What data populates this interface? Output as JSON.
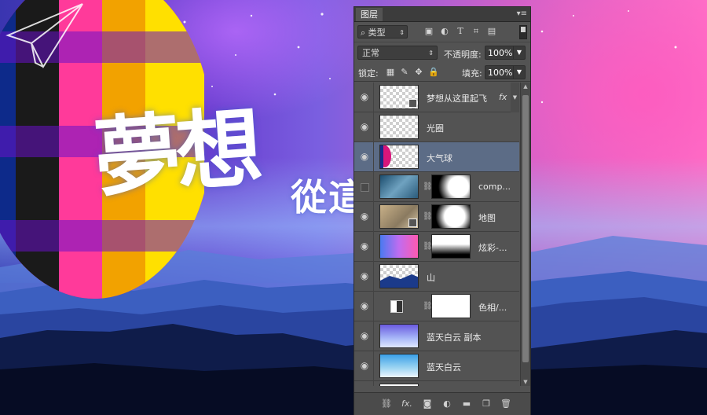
{
  "background": {
    "calligraphy_main": "夢想",
    "calligraphy_secondary": "從這"
  },
  "panel": {
    "tab_label": "图层",
    "menu_icon": "panel-menu-icon",
    "filter": {
      "kind_label": "类型",
      "icons": [
        "image-filter-icon",
        "adjustment-filter-icon",
        "type-filter-icon",
        "shape-filter-icon",
        "smart-object-filter-icon"
      ]
    },
    "blend_mode": "正常",
    "opacity_label": "不透明度:",
    "opacity_value": "100%",
    "lock_label": "锁定:",
    "fill_label": "填充:",
    "fill_value": "100%",
    "layers": [
      {
        "name": "梦想从这里起飞",
        "visible": true,
        "fx": "fx"
      },
      {
        "name": "光圈",
        "visible": true
      },
      {
        "name": "大气球",
        "visible": true,
        "selected": true
      },
      {
        "name": "comp...",
        "visible": false
      },
      {
        "name": "地图",
        "visible": true
      },
      {
        "name": "炫彩-...",
        "visible": true
      },
      {
        "name": "山",
        "visible": true
      },
      {
        "name": "色相/...",
        "visible": true
      },
      {
        "name": "蓝天白云 副本",
        "visible": true
      },
      {
        "name": "蓝天白云",
        "visible": true
      }
    ],
    "footer_icons": [
      "link-layers-icon",
      "fx-icon",
      "mask-icon",
      "adjustment-layer-icon",
      "group-folder-icon",
      "new-layer-icon",
      "trash-icon"
    ],
    "footer_fx": "fx."
  }
}
